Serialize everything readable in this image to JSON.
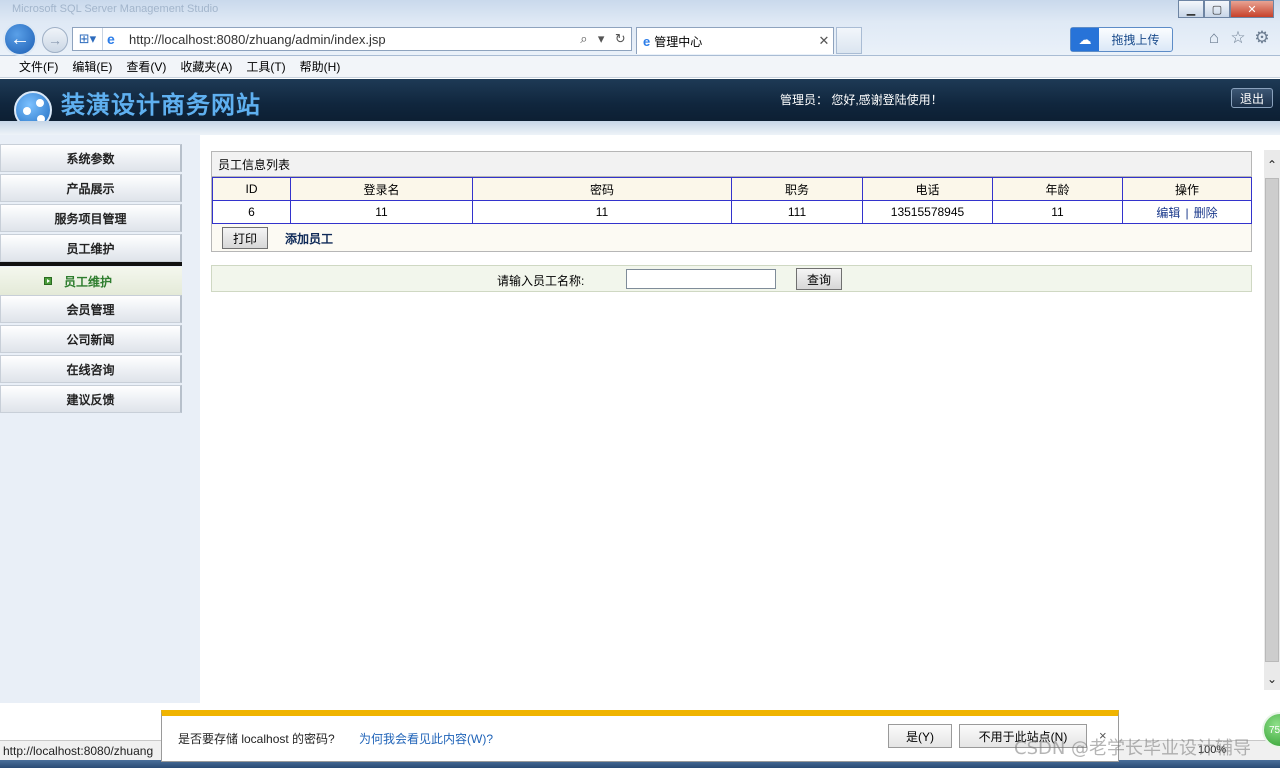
{
  "browser": {
    "window_ghost_title": "Microsoft SQL Server Management Studio",
    "address_url": "http://localhost:8080/zhuang/admin/index.jsp",
    "tab_title": "管理中心",
    "upload_label": "拖拽上传",
    "menu": [
      "文件(F)",
      "编辑(E)",
      "查看(V)",
      "收藏夹(A)",
      "工具(T)",
      "帮助(H)"
    ],
    "status_url": "http://localhost:8080/zhuang",
    "zoom": "100%",
    "zoom_badge": "75"
  },
  "site": {
    "title": "装潢设计商务网站",
    "greeting": "管理员： 您好,感谢登陆使用！",
    "logout_label": "退出"
  },
  "sidebar": {
    "items": [
      {
        "label": "系统参数"
      },
      {
        "label": "产品展示"
      },
      {
        "label": "服务项目管理"
      },
      {
        "label": "员工维护"
      },
      {
        "label": "员工维护"
      },
      {
        "label": "会员管理"
      },
      {
        "label": "公司新闻"
      },
      {
        "label": "在线咨询"
      },
      {
        "label": "建议反馈"
      }
    ]
  },
  "employee_list": {
    "title": "员工信息列表",
    "columns": [
      "ID",
      "登录名",
      "密码",
      "职务",
      "电话",
      "年龄",
      "操作"
    ],
    "rows": [
      {
        "id": "6",
        "login": "11",
        "password": "11",
        "position": "111",
        "phone": "13515578945",
        "age": "11",
        "edit": "编辑",
        "sep": "|",
        "delete": "删除"
      }
    ],
    "print_label": "打印",
    "add_label": "添加员工"
  },
  "search": {
    "label": "请输入员工名称:",
    "value": "",
    "button_label": "查询"
  },
  "password_prompt": {
    "question": "是否要存储 localhost 的密码?",
    "link": "为何我会看见此内容(W)?",
    "yes_label": "是(Y)",
    "no_label": "不用于此站点(N)",
    "close": "×"
  },
  "watermark": "CSDN @老学长毕业设计辅导"
}
